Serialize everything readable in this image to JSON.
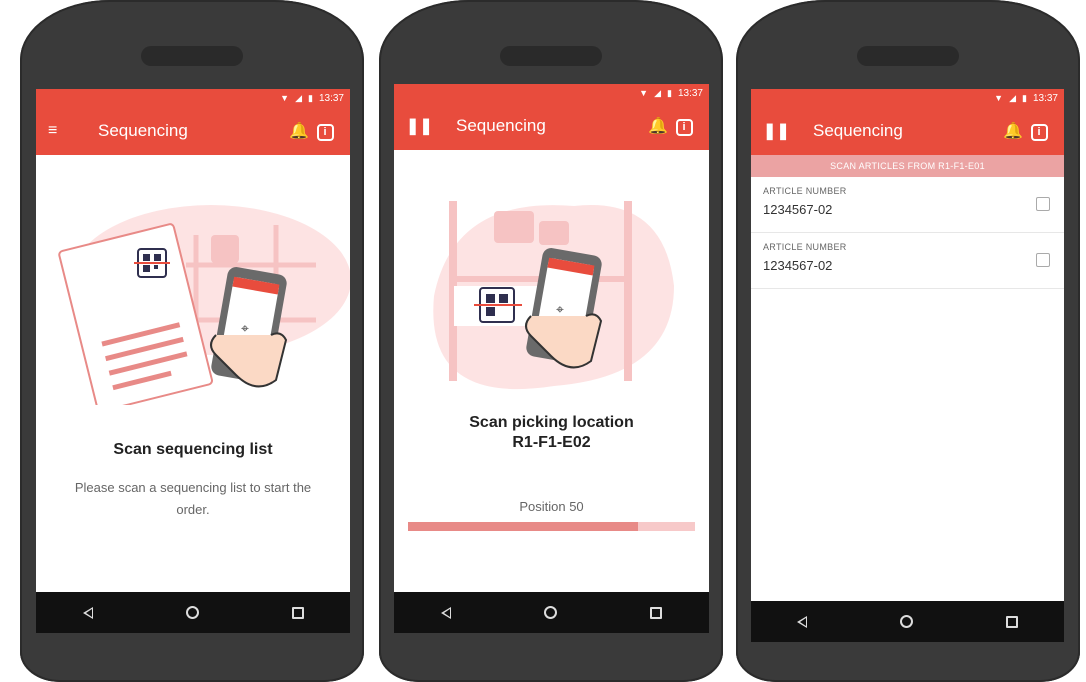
{
  "status": {
    "time": "13:37",
    "wifi_icon": "wifi-icon",
    "signal_icon": "signal-icon",
    "battery_icon": "battery-icon"
  },
  "screens": [
    {
      "menu_icon": "menu-icon",
      "title": "Sequencing",
      "heading": "Scan sequencing list",
      "description": "Please scan a sequencing list to start the order."
    },
    {
      "pause_icon": "pause-icon",
      "title": "Sequencing",
      "heading_line1": "Scan picking location",
      "heading_line2": "R1-F1-E02",
      "position_label": "Position 50",
      "progress": 0.8
    },
    {
      "pause_icon": "pause-icon",
      "title": "Sequencing",
      "banner": "SCAN ARTICLES  FROM R1-F1-E01",
      "articles": [
        {
          "label": "ARTICLE NUMBER",
          "value": "1234567-02"
        },
        {
          "label": "ARTICLE NUMBER",
          "value": "1234567-02"
        }
      ]
    }
  ],
  "colors": {
    "accent": "#e84c3d",
    "accent_light": "#f7c9c9",
    "nav": "#111111",
    "frame": "#3a3a3a"
  }
}
